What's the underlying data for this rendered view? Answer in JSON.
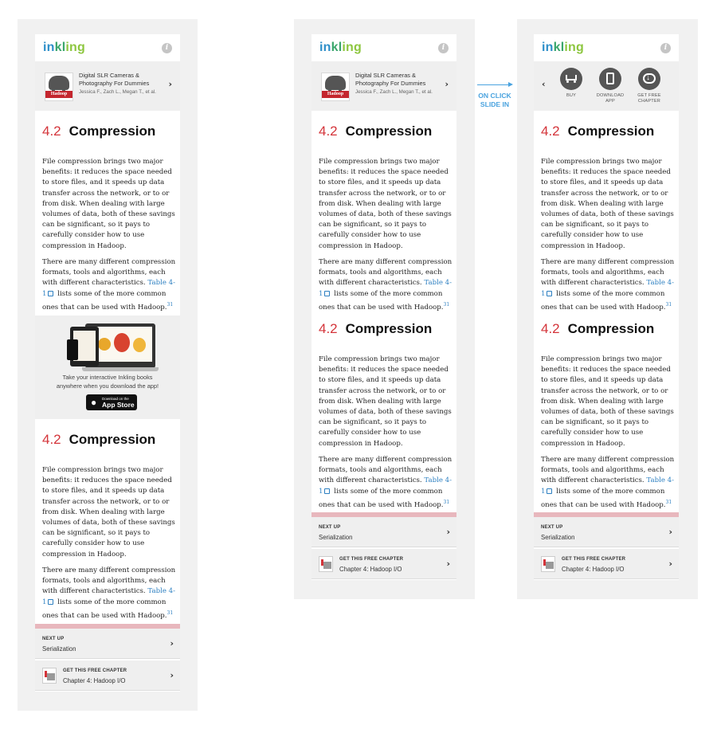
{
  "app": {
    "logo_parts": [
      "in",
      "kl",
      "ing"
    ],
    "info_icon": "i"
  },
  "book": {
    "title_line1": "Digital SLR Cameras &",
    "title_line2": "Photography For Dummies",
    "authors": "Jessica F., Zach L., Megan T., et al.",
    "cover_text": "Hadoop"
  },
  "section": {
    "number": "4.2",
    "title": "Compression",
    "para1": "File compression brings two major benefits: it reduces the space needed to store files, and it speeds up data transfer across the network, or to or from disk. When dealing with large volumes of data, both of these savings can be significant, so it pays to carefully consider how to use compression in Hadoop.",
    "para2_before": "There are many different compression formats, tools and algorithms, each with different characteristics. ",
    "para2_link": "Table 4-1",
    "para2_after": " lists some of the more common ones that can be used with Hadoop.",
    "footnote": "31"
  },
  "promo": {
    "line1": "Take your interactive Inkling books",
    "line2": "anywhere when you download the app!",
    "badge_small": "Download on the",
    "badge_big": "App Store"
  },
  "footer": {
    "next_label": "NEXT UP",
    "next_value": "Serialization",
    "chapter_label": "GET THIS FREE CHAPTER",
    "chapter_value": "Chapter 4: Hadoop I/O"
  },
  "transition": {
    "line1": "ON CLICK",
    "line2": "SLIDE IN"
  },
  "actions": [
    {
      "label": "BUY",
      "label2": "",
      "icon": "cart-icon"
    },
    {
      "label": "DOWNLOAD",
      "label2": "APP",
      "icon": "tablet-icon"
    },
    {
      "label": "GET FREE",
      "label2": "CHAPTER",
      "icon": "cloud-download-icon"
    }
  ],
  "colors": {
    "accent_red": "#d4343a",
    "link_blue": "#2c7fc1",
    "transition_blue": "#4aa3df",
    "pink_bar": "#e8b7bd"
  }
}
